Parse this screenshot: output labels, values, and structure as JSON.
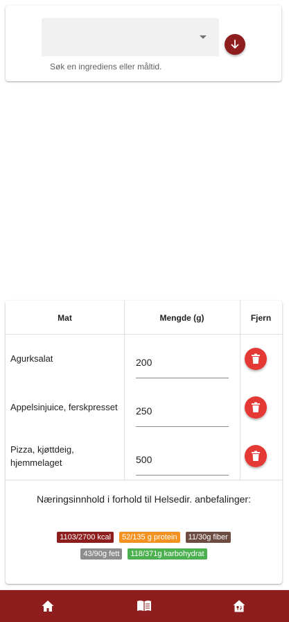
{
  "search": {
    "selected_value": "",
    "helper_text": "Søk en ingrediens eller måltid."
  },
  "table": {
    "headers": {
      "food": "Mat",
      "amount": "Mengde (g)",
      "remove": "Fjern"
    },
    "rows": [
      {
        "food": "Agurksalat",
        "amount": "200"
      },
      {
        "food": "Appelsinjuice, ferskpresset",
        "amount": "250"
      },
      {
        "food": "Pizza, kjøttdeig, hjemmelaget",
        "amount": "500"
      }
    ]
  },
  "nutrition": {
    "title": "Næringsinnhold i forhold til Helsedir. anbefalinger:",
    "badges": [
      {
        "text": "1103/2700 kcal",
        "color": "#8e1d1d"
      },
      {
        "text": "52/135 g protein",
        "color": "#f39220"
      },
      {
        "text": "11/30g fiber",
        "color": "#6d4c41"
      },
      {
        "text": "43/90g fett",
        "color": "#8d8d8d"
      },
      {
        "text": "118/371g karbohydrat",
        "color": "#4caf50"
      }
    ]
  },
  "colors": {
    "primary": "#8e1d1d",
    "delete": "#e53935"
  },
  "icons": {
    "search_button": "arrow-down-icon",
    "delete": "trash-icon",
    "nav": [
      "home-icon",
      "book-icon",
      "house-food-icon"
    ]
  }
}
